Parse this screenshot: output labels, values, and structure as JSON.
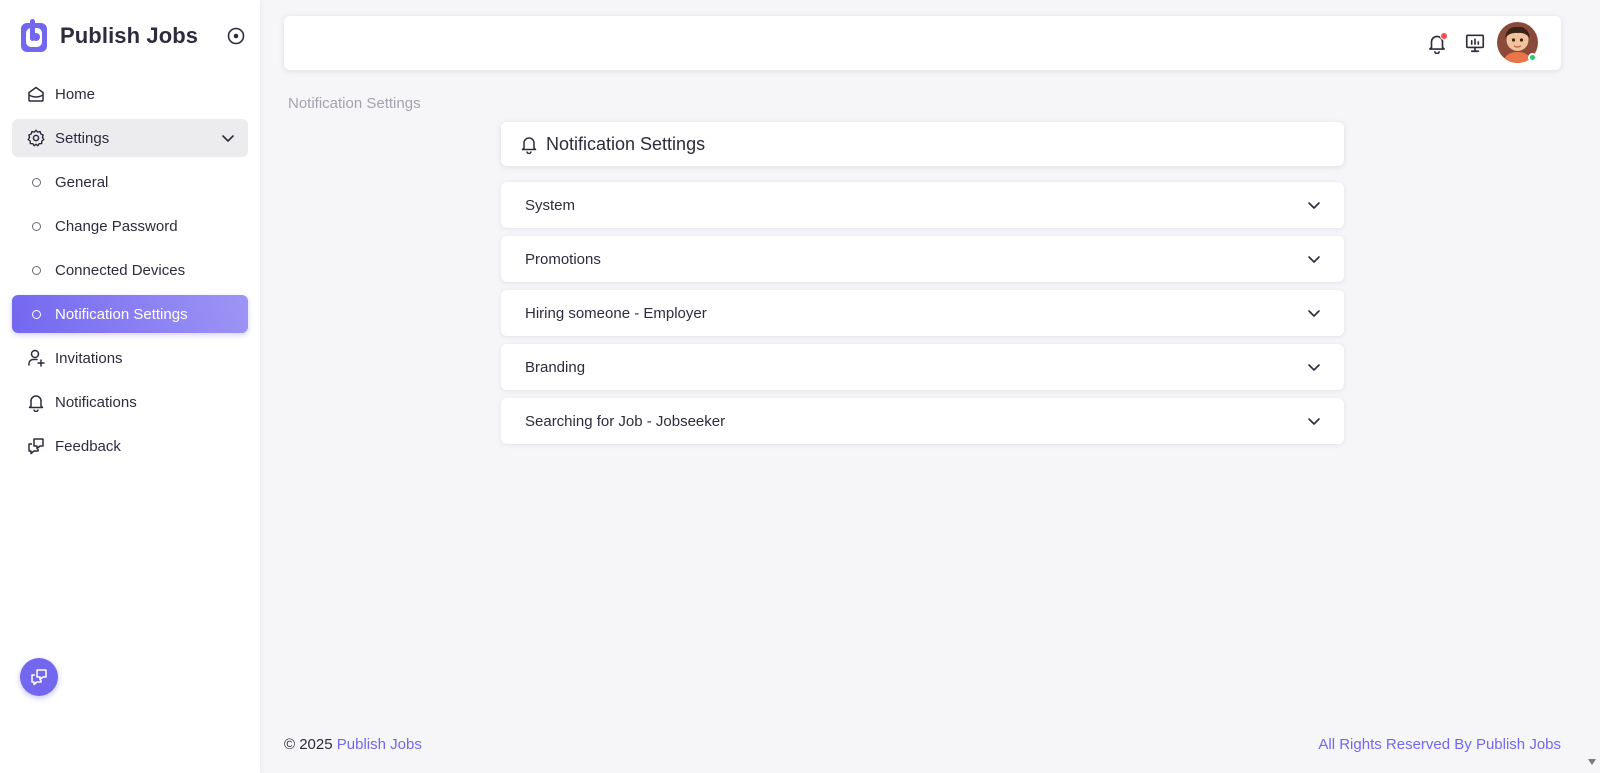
{
  "app": {
    "brand_name": "Publish Jobs",
    "accent_color": "#7367f0",
    "online_color": "#28c76f",
    "alert_color": "#ff4c51"
  },
  "sidebar": {
    "items": [
      {
        "label": "Home",
        "icon": "home-icon"
      },
      {
        "label": "Settings",
        "icon": "gear-icon",
        "expanded": true
      },
      {
        "label": "General",
        "icon": "bullet"
      },
      {
        "label": "Change Password",
        "icon": "bullet"
      },
      {
        "label": "Connected Devices",
        "icon": "bullet"
      },
      {
        "label": "Notification Settings",
        "icon": "bullet",
        "active": true
      },
      {
        "label": "Invitations",
        "icon": "user-plus-icon"
      },
      {
        "label": "Notifications",
        "icon": "bell-icon"
      },
      {
        "label": "Feedback",
        "icon": "feedback-icon"
      }
    ]
  },
  "breadcrumb": "Notification Settings",
  "main": {
    "title": "Notification Settings",
    "sections": [
      {
        "label": "System"
      },
      {
        "label": "Promotions"
      },
      {
        "label": "Hiring someone - Employer"
      },
      {
        "label": "Branding"
      },
      {
        "label": "Searching for Job - Jobseeker"
      }
    ]
  },
  "footer": {
    "copyright": "© 2025 ",
    "brand_link": "Publish Jobs",
    "rights": "All Rights Reserved By Publish Jobs"
  }
}
